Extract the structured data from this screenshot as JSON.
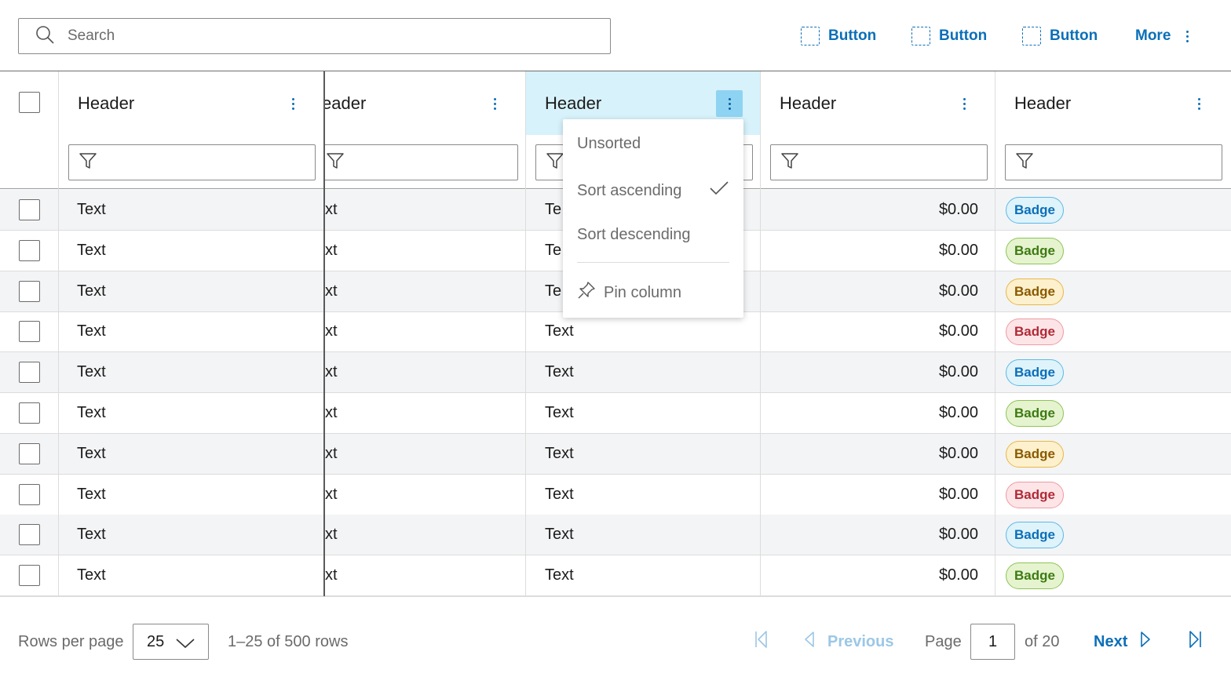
{
  "toolbar": {
    "search": {
      "placeholder": "Search",
      "value": ""
    },
    "buttons": [
      "Button",
      "Button",
      "Button"
    ],
    "more_label": "More"
  },
  "table": {
    "headers": [
      "Header",
      "eader",
      "Header",
      "Header",
      "Header"
    ],
    "rows": [
      {
        "c1": "Text",
        "c2": "xt",
        "c3": "Te",
        "c4": "$0.00",
        "badge": "Badge",
        "badge_tone": "blue"
      },
      {
        "c1": "Text",
        "c2": "xt",
        "c3": "Te",
        "c4": "$0.00",
        "badge": "Badge",
        "badge_tone": "green"
      },
      {
        "c1": "Text",
        "c2": "xt",
        "c3": "Te",
        "c4": "$0.00",
        "badge": "Badge",
        "badge_tone": "yellow"
      },
      {
        "c1": "Text",
        "c2": "xt",
        "c3": "Text",
        "c4": "$0.00",
        "badge": "Badge",
        "badge_tone": "red"
      },
      {
        "c1": "Text",
        "c2": "xt",
        "c3": "Text",
        "c4": "$0.00",
        "badge": "Badge",
        "badge_tone": "blue"
      },
      {
        "c1": "Text",
        "c2": "xt",
        "c3": "Text",
        "c4": "$0.00",
        "badge": "Badge",
        "badge_tone": "green"
      },
      {
        "c1": "Text",
        "c2": "xt",
        "c3": "Text",
        "c4": "$0.00",
        "badge": "Badge",
        "badge_tone": "yellow"
      },
      {
        "c1": "Text",
        "c2": "xt",
        "c3": "Text",
        "c4": "$0.00",
        "badge": "Badge",
        "badge_tone": "red"
      },
      {
        "c1": "Text",
        "c2": "xt",
        "c3": "Text",
        "c4": "$0.00",
        "badge": "Badge",
        "badge_tone": "blue"
      },
      {
        "c1": "Text",
        "c2": "xt",
        "c3": "Text",
        "c4": "$0.00",
        "badge": "Badge",
        "badge_tone": "green"
      }
    ]
  },
  "column_menu": {
    "items": [
      "Unsorted",
      "Sort ascending",
      "Sort descending"
    ],
    "selected": "Sort ascending",
    "pin_label": "Pin column"
  },
  "pagination": {
    "rows_per_page_label": "Rows per page",
    "rows_per_page_value": "25",
    "range_text": "1–25 of 500 rows",
    "previous_label": "Previous",
    "page_label": "Page",
    "current_page": "1",
    "of_text": "of 20",
    "next_label": "Next"
  },
  "colors": {
    "accent": "#0b6fb8",
    "active_header_bg": "#d7f2fb",
    "active_kebab_bg": "#8fd3f2",
    "zebra": "#f3f4f6"
  }
}
